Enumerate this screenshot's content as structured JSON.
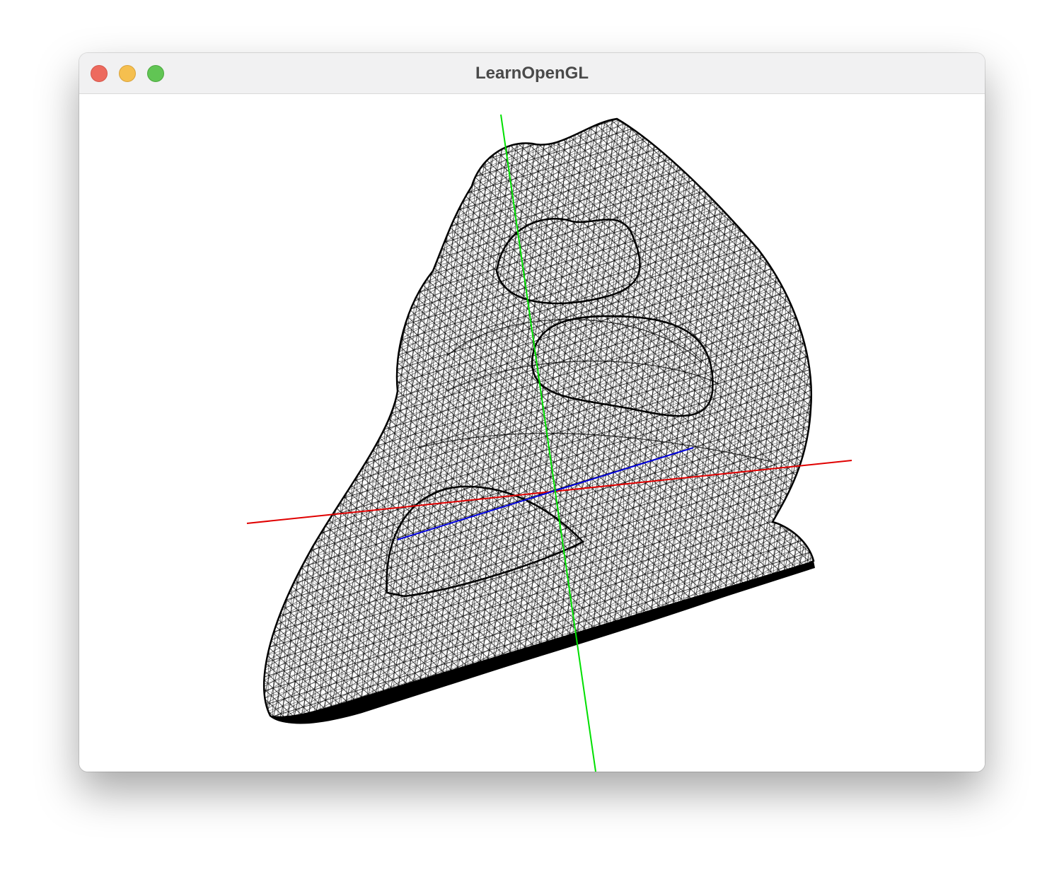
{
  "window": {
    "title": "LearnOpenGL",
    "controls": {
      "close": "close-button",
      "minimize": "minimize-button",
      "zoom": "zoom-button"
    },
    "colors": {
      "close": "#ed6a5e",
      "minimize": "#f5bf4f",
      "zoom": "#61c554"
    }
  },
  "scene": {
    "render_mode": "wireframe",
    "background": "#ffffff",
    "mesh_color": "#000000",
    "axes": {
      "x_color": "#e00000",
      "y_color": "#00e000",
      "z_color": "#0000e0"
    }
  }
}
